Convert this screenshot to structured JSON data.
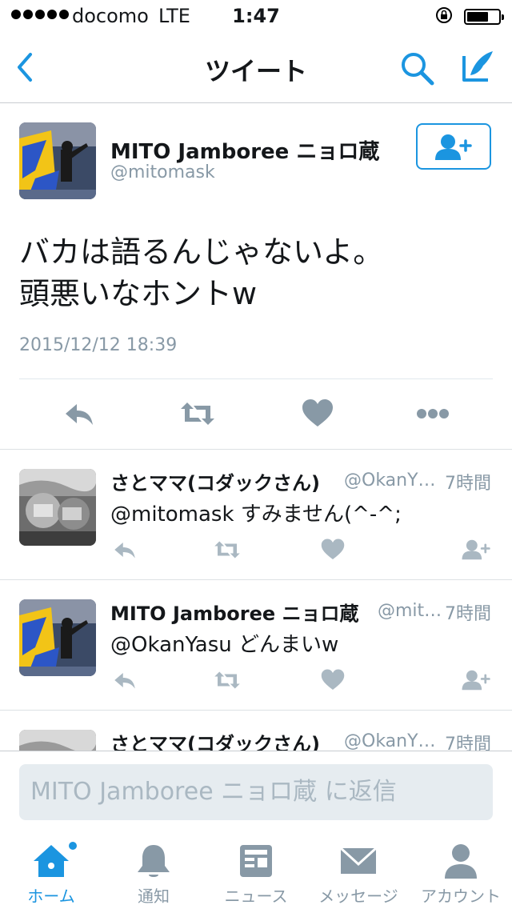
{
  "status_bar": {
    "carrier": "docomo",
    "network": "LTE",
    "time": "1:47"
  },
  "nav": {
    "title": "ツイート"
  },
  "main_tweet": {
    "author_name": "MITO Jamboree ニョロ蔵",
    "author_handle": "@mitomask",
    "text_line1": "バカは語るんじゃないよ。",
    "text_line2": "頭悪いなホントw",
    "date": "2015/12/12 18:39"
  },
  "replies": [
    {
      "name": "さとママ(コダックさん)",
      "handle": "@OkanY…",
      "time": "7時間",
      "text": "@mitomask すみません(^-^;"
    },
    {
      "name": "MITO Jamboree ニョロ蔵",
      "handle": "@mit…",
      "time": "7時間",
      "text": "@OkanYasu どんまいw"
    },
    {
      "name": "さとママ(コダックさん)",
      "handle": "@OkanY…",
      "time": "7時間",
      "text": ""
    }
  ],
  "reply_bar": {
    "placeholder": "MITO Jamboree ニョロ蔵 に返信"
  },
  "tabs": [
    {
      "label": "ホーム",
      "icon": "home-icon",
      "active": true
    },
    {
      "label": "通知",
      "icon": "bell-icon",
      "active": false
    },
    {
      "label": "ニュース",
      "icon": "news-icon",
      "active": false
    },
    {
      "label": "メッセージ",
      "icon": "envelope-icon",
      "active": false
    },
    {
      "label": "アカウント",
      "icon": "person-icon",
      "active": false
    }
  ],
  "colors": {
    "accent": "#1b95e0",
    "icon_gray": "#8899a6",
    "divider": "#e1e8ed"
  }
}
